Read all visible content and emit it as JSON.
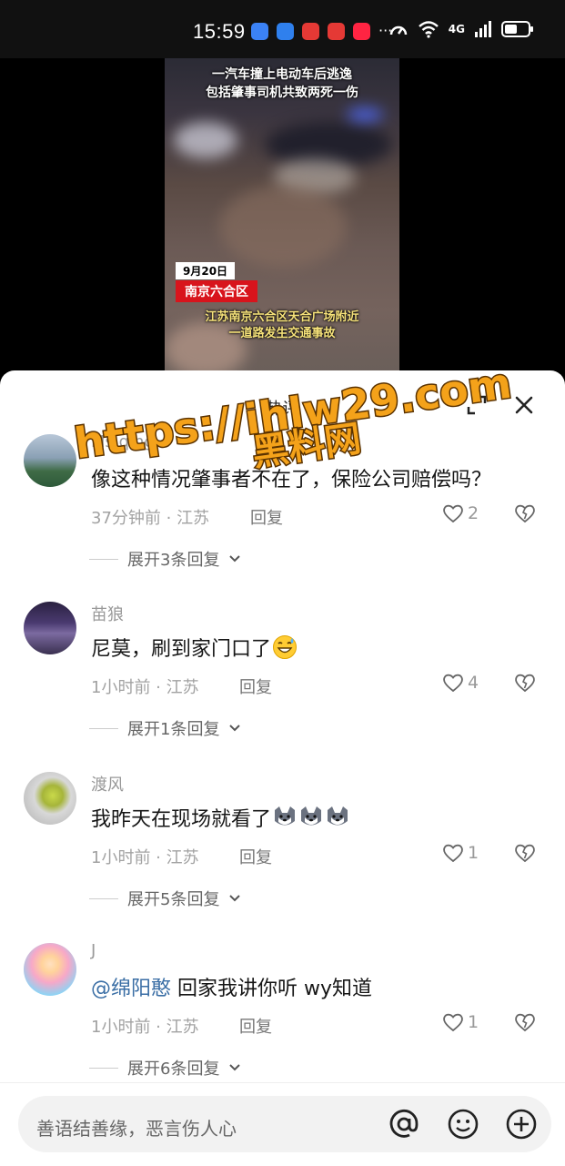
{
  "status_bar": {
    "time": "15:59",
    "network": "4G",
    "battery_level": 0.55,
    "app_icons": [
      {
        "name": "radar-app-icon",
        "color": "#3b82f6"
      },
      {
        "name": "message-app-icon",
        "color": "#2f80ed"
      },
      {
        "name": "huawei-app-icon-1",
        "color": "#e53935"
      },
      {
        "name": "huawei-app-icon-2",
        "color": "#e53935"
      },
      {
        "name": "xiaohongshu-app-icon",
        "color": "#ff2442"
      }
    ],
    "more": "···"
  },
  "video": {
    "headline_line1": "一汽车撞上电动车后逃逸",
    "headline_line2": "包括肇事司机共致两死一伤",
    "date_tag": "9月20日",
    "location_tag": "南京六合区",
    "subtitle_line1": "江苏南京六合区天合广场附近",
    "subtitle_line2": "一道路发生交通事故"
  },
  "sheet": {
    "title": "热评"
  },
  "comments": [
    {
      "user": "Ms.qing",
      "text": "像这种情况肇事者不在了，保险公司赔偿吗？",
      "time_place": "37分钟前 · 江苏",
      "reply_label": "回复",
      "likes": "2",
      "expand": "展开3条回复"
    },
    {
      "user": "苗狼",
      "text": "尼莫，刷到家门口了",
      "emoji": "grin-sweat-emoji",
      "time_place": "1小时前 · 江苏",
      "reply_label": "回复",
      "likes": "4",
      "expand": "展开1条回复"
    },
    {
      "user": "渡风",
      "text": "我昨天在现场就看了",
      "emoji": "husky-emoji",
      "time_place": "1小时前 · 江苏",
      "reply_label": "回复",
      "likes": "1",
      "expand": "展开5条回复"
    },
    {
      "user": "J",
      "mention": "@绵阳憨",
      "text": " 回家我讲你听 wy知道",
      "time_place": "1小时前 · 江苏",
      "reply_label": "回复",
      "likes": "1",
      "expand": "展开6条回复"
    }
  ],
  "input": {
    "placeholder": "善语结善缘，恶言伤人心"
  },
  "watermark": {
    "url": "https://ihlw29.com",
    "site": "黑料网"
  }
}
